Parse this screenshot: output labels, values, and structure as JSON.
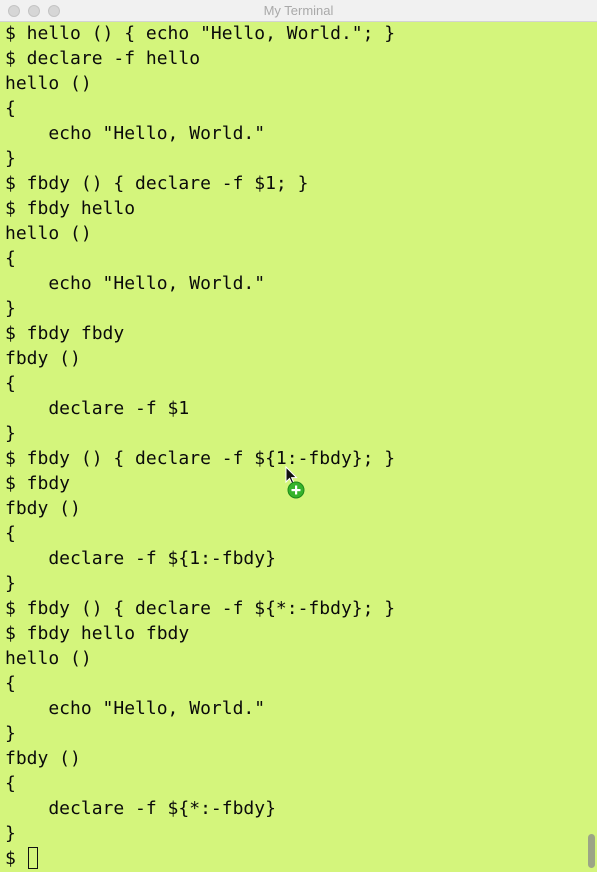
{
  "window": {
    "title": "My Terminal"
  },
  "terminal": {
    "background": "#d4f57c",
    "text_color": "#0a0a0a",
    "lines": [
      "$ hello () { echo \"Hello, World.\"; }",
      "$ declare -f hello",
      "hello ()",
      "{",
      "    echo \"Hello, World.\"",
      "}",
      "$ fbdy () { declare -f $1; }",
      "$ fbdy hello",
      "hello ()",
      "{",
      "    echo \"Hello, World.\"",
      "}",
      "$ fbdy fbdy",
      "fbdy ()",
      "{",
      "    declare -f $1",
      "}",
      "$ fbdy () { declare -f ${1:-fbdy}; }",
      "$ fbdy",
      "fbdy ()",
      "{",
      "    declare -f ${1:-fbdy}",
      "}",
      "$ fbdy () { declare -f ${*:-fbdy}; }",
      "$ fbdy hello fbdy",
      "hello ()",
      "{",
      "    echo \"Hello, World.\"",
      "}",
      "fbdy ()",
      "{",
      "    declare -f ${*:-fbdy}",
      "}"
    ],
    "prompt": "$ "
  },
  "icons": {
    "cursor_pointer": "arrow-pointer-with-green-plus-icon"
  }
}
